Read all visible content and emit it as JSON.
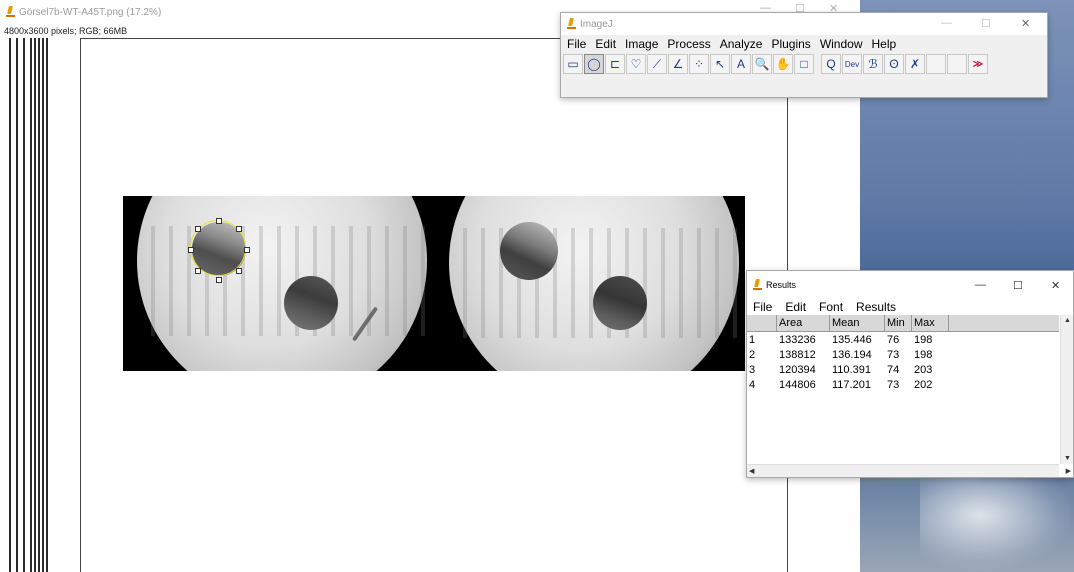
{
  "image_window": {
    "title": "Görsel7b-WT-A45T.png (17.2%)",
    "subtitle": "4800x3600 pixels; RGB; 66MB"
  },
  "imagej": {
    "title": "ImageJ",
    "menu": [
      "File",
      "Edit",
      "Image",
      "Process",
      "Analyze",
      "Plugins",
      "Window",
      "Help"
    ],
    "tools": [
      {
        "name": "rectangle-tool",
        "glyph": "▭"
      },
      {
        "name": "oval-tool",
        "glyph": "◯"
      },
      {
        "name": "polygon-tool",
        "glyph": "⊏"
      },
      {
        "name": "freehand-tool",
        "glyph": "♡"
      },
      {
        "name": "line-tool",
        "glyph": "⟋"
      },
      {
        "name": "angle-tool",
        "glyph": "∠"
      },
      {
        "name": "point-tool",
        "glyph": "⁘"
      },
      {
        "name": "wand-tool",
        "glyph": "↖"
      },
      {
        "name": "text-tool",
        "glyph": "A"
      },
      {
        "name": "zoom-tool",
        "glyph": "🔍"
      },
      {
        "name": "hand-tool",
        "glyph": "✋"
      },
      {
        "name": "color-picker-tool",
        "glyph": "□"
      },
      {
        "name": "magnifier-tool",
        "glyph": "Q"
      },
      {
        "name": "dev-tool",
        "glyph": "Dev"
      },
      {
        "name": "brush-tool",
        "glyph": "ℬ"
      },
      {
        "name": "flood-tool",
        "glyph": "ʘ"
      },
      {
        "name": "pencil-tool",
        "glyph": "✗"
      },
      {
        "name": "empty-tool-1",
        "glyph": ""
      },
      {
        "name": "empty-tool-2",
        "glyph": ""
      },
      {
        "name": "more-tools",
        "glyph": "≫"
      }
    ],
    "controls": {
      "minimize": "—",
      "maximize": "☐",
      "close": "✕"
    }
  },
  "results": {
    "title": "Results",
    "menu": [
      "File",
      "Edit",
      "Font",
      "Results"
    ],
    "columns": [
      "",
      "Area",
      "Mean",
      "Min",
      "Max"
    ],
    "rows": [
      [
        "1",
        "133236",
        "135.446",
        "76",
        "198"
      ],
      [
        "2",
        "138812",
        "136.194",
        "73",
        "198"
      ],
      [
        "3",
        "120394",
        "110.391",
        "74",
        "203"
      ],
      [
        "4",
        "144806",
        "117.201",
        "73",
        "202"
      ]
    ],
    "controls": {
      "minimize": "—",
      "maximize": "☐",
      "close": "✕"
    }
  },
  "colors": {
    "roi": "#e8e22a",
    "accent": "#c0204a"
  }
}
